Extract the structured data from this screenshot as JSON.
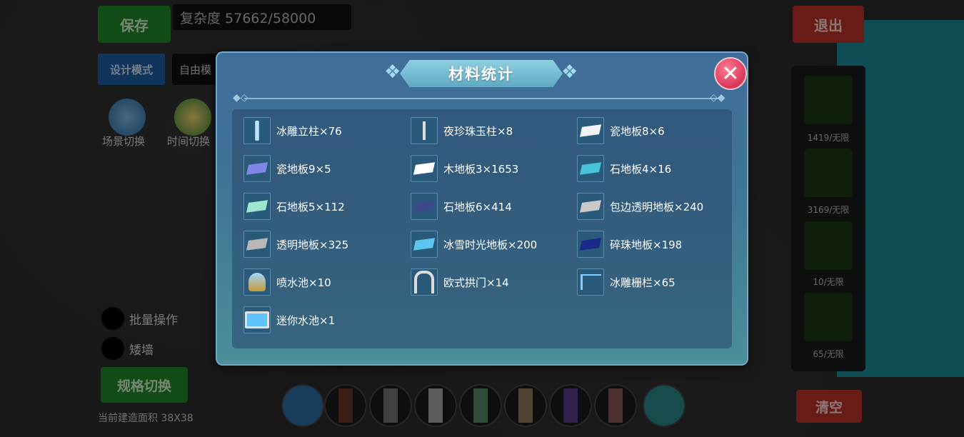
{
  "background_ui": {
    "save_label": "保存",
    "complexity_text": "复杂度 57662/58000",
    "design_mode_label": "设计模式",
    "free_mode_label": "自由模",
    "scene_switch_label": "场景切换",
    "time_switch_label": "时间切换",
    "batch_op_label": "批量操作",
    "low_wall_label": "矮墙",
    "spec_switch_label": "规格切换",
    "area_text": "当前建造面积 38X38",
    "exit_label": "退出",
    "clear_label": "清空",
    "right_counters": [
      "1419/无限",
      "3169/无限",
      "10/无限",
      "65/无限"
    ]
  },
  "modal": {
    "title": "材料统计",
    "close_symbol": "✕",
    "items": [
      {
        "label": "冰雕立柱×76",
        "icon": "ice-pillar-icon"
      },
      {
        "label": "夜珍珠玉柱×8",
        "icon": "pearl-pillar-icon"
      },
      {
        "label": "瓷地板8×6",
        "icon": "porcelain-floor-icon"
      },
      {
        "label": "瓷地板9×5",
        "icon": "porcelain-floor-icon"
      },
      {
        "label": "木地板3×1653",
        "icon": "wood-floor-icon"
      },
      {
        "label": "石地板4×16",
        "icon": "stone-floor-icon"
      },
      {
        "label": "石地板5×112",
        "icon": "stone-floor-icon"
      },
      {
        "label": "石地板6×414",
        "icon": "stone-floor-icon"
      },
      {
        "label": "包边透明地板×240",
        "icon": "edged-glass-floor-icon"
      },
      {
        "label": "透明地板×325",
        "icon": "glass-floor-icon"
      },
      {
        "label": "冰雪时光地板×200",
        "icon": "ice-snow-floor-icon"
      },
      {
        "label": "碎珠地板×198",
        "icon": "bead-floor-icon"
      },
      {
        "label": "喷水池×10",
        "icon": "fountain-icon"
      },
      {
        "label": "欧式拱门×14",
        "icon": "arch-icon"
      },
      {
        "label": "冰雕栅栏×65",
        "icon": "ice-fence-icon"
      },
      {
        "label": "迷你水池×1",
        "icon": "mini-pool-icon"
      }
    ]
  },
  "colors": {
    "modal_top": "#3f6d99",
    "modal_bottom": "#4a8f9a",
    "close_red": "#d83557",
    "title_banner": "#8ed0e2"
  }
}
